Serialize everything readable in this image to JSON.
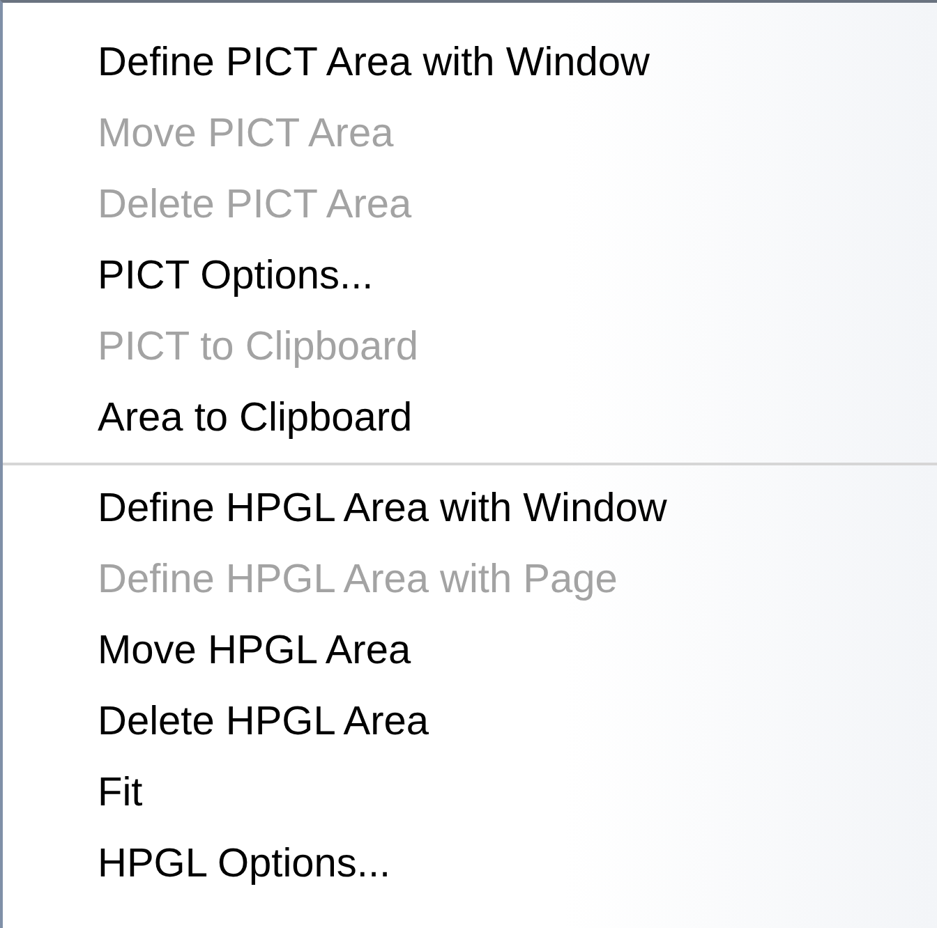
{
  "menu": {
    "sections": [
      {
        "items": [
          {
            "label": "Define PICT Area with Window",
            "disabled": false
          },
          {
            "label": "Move PICT Area",
            "disabled": true
          },
          {
            "label": "Delete PICT Area",
            "disabled": true
          },
          {
            "label": "PICT Options...",
            "disabled": false
          },
          {
            "label": "PICT to Clipboard",
            "disabled": true
          },
          {
            "label": "Area to Clipboard",
            "disabled": false
          }
        ]
      },
      {
        "items": [
          {
            "label": "Define HPGL Area with Window",
            "disabled": false
          },
          {
            "label": "Define HPGL Area with Page",
            "disabled": true
          },
          {
            "label": "Move HPGL Area",
            "disabled": false
          },
          {
            "label": "Delete HPGL Area",
            "disabled": false
          },
          {
            "label": "Fit",
            "disabled": false
          },
          {
            "label": "HPGL Options...",
            "disabled": false
          }
        ]
      }
    ]
  }
}
